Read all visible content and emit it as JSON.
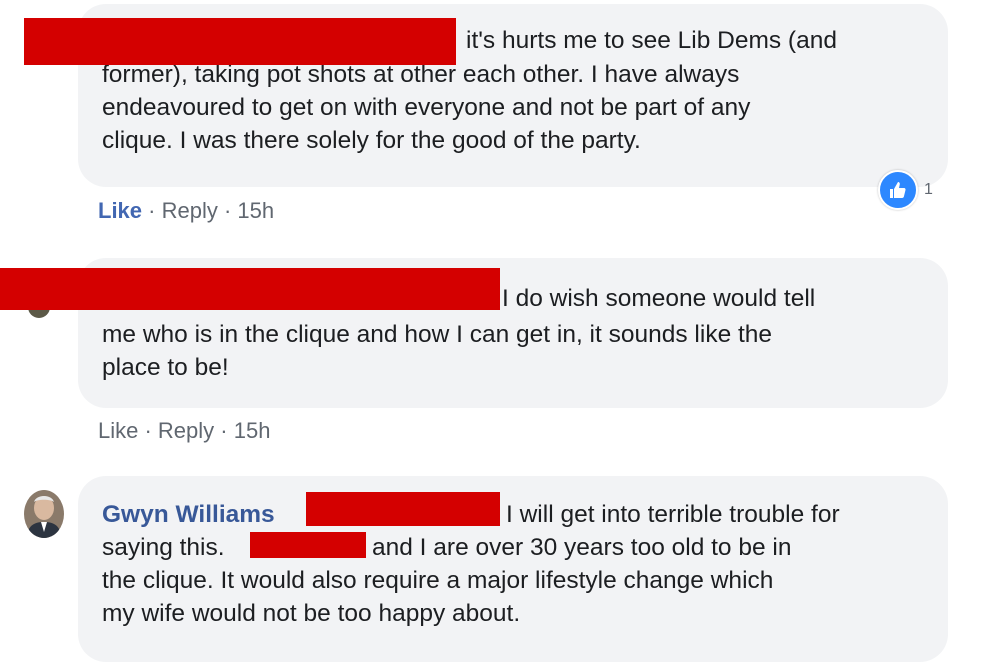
{
  "comments": [
    {
      "text_line1": "it's hurts me to see Lib Dems (and",
      "text_rest": "former), taking pot shots at other each other. I have always\nendeavoured to get on with everyone and not be part of any\nclique. I was there solely for the good of the party.",
      "actions": {
        "like": "Like",
        "sep1": " · ",
        "reply": "Reply",
        "sep2": " · ",
        "time": "15h"
      },
      "reaction_count": "1"
    },
    {
      "text_line1": "I do wish someone would tell",
      "text_rest": "me who is in the clique and how I can get in, it sounds like the\nplace to be!",
      "actions": {
        "like": "Like",
        "sep1": " · ",
        "reply": "Reply",
        "sep2": " · ",
        "time": "15h"
      }
    },
    {
      "author": "Gwyn Williams",
      "text_line1_after": "I will get into terrible trouble for",
      "text_line2_before": "saying this.",
      "text_line2_after": "and I are over 30 years too old to be in",
      "text_rest": "the clique. It would also require a major lifestyle change which\nmy wife would not be too happy about."
    }
  ],
  "colors": {
    "bubble": "#f2f3f5",
    "redaction": "#d40000",
    "link": "#4267b2",
    "author": "#385898",
    "like_reaction": "#2d88ff"
  },
  "icons": {
    "reaction": "thumbs-up-icon"
  }
}
